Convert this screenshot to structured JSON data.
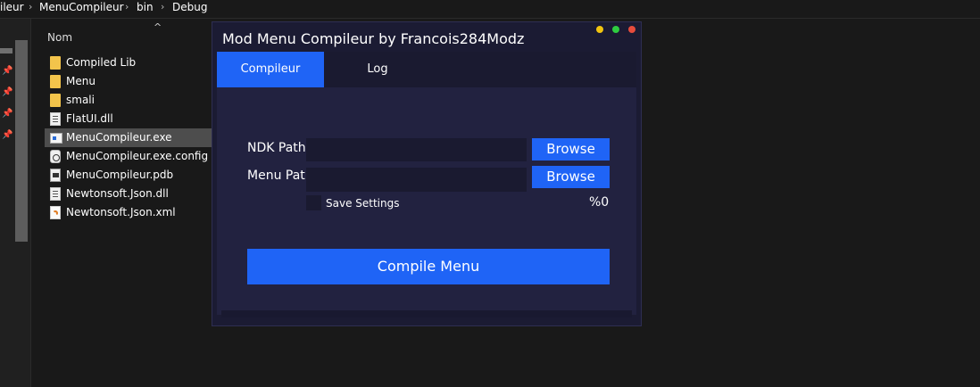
{
  "explorer": {
    "breadcrumb": [
      "ileur",
      "MenuCompileur",
      "bin",
      "Debug"
    ],
    "column_header": "Nom",
    "files": [
      {
        "name": "Compiled Lib",
        "icon": "folder-icon"
      },
      {
        "name": "Menu",
        "icon": "folder-icon"
      },
      {
        "name": "smali",
        "icon": "folder-icon"
      },
      {
        "name": "FlatUI.dll",
        "icon": "dll-file-icon"
      },
      {
        "name": "MenuCompileur.exe",
        "icon": "exe-file-icon",
        "selected": true
      },
      {
        "name": "MenuCompileur.exe.config",
        "icon": "config-file-icon"
      },
      {
        "name": "MenuCompileur.pdb",
        "icon": "pdb-file-icon"
      },
      {
        "name": "Newtonsoft.Json.dll",
        "icon": "dll-file-icon"
      },
      {
        "name": "Newtonsoft.Json.xml",
        "icon": "xml-file-icon"
      }
    ]
  },
  "app": {
    "title": "Mod Menu Compileur by Francois284Modz",
    "window_controls": {
      "minimize": "#f1c40f",
      "maximize": "#2ecc40",
      "close": "#e74c3c"
    },
    "tabs": [
      {
        "label": "Compileur",
        "active": true
      },
      {
        "label": "Log",
        "active": false
      }
    ],
    "form": {
      "ndk_label": "NDK Path",
      "ndk_value": "",
      "menu_label": "Menu Path",
      "menu_value": "",
      "browse_label": "Browse",
      "save_settings_label": "Save Settings",
      "save_settings_checked": false,
      "progress_text": "%0",
      "compile_label": "Compile Menu"
    },
    "accent": "#1f64f6"
  }
}
